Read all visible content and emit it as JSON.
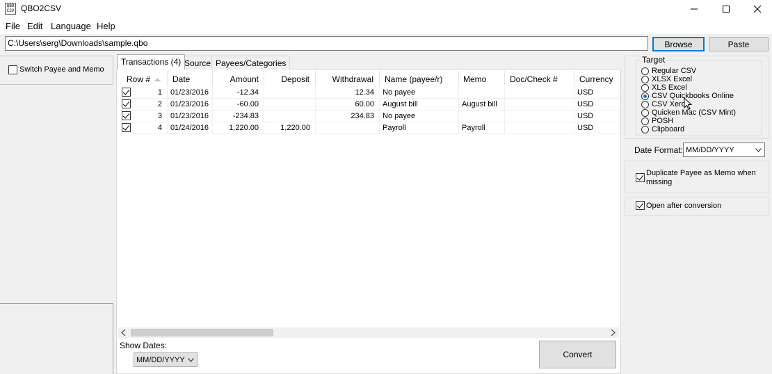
{
  "window": {
    "title": "QBO2CSV",
    "icon_text": "QBO\nCSV",
    "minimize": "—",
    "maximize": "☐",
    "close": "✕"
  },
  "menu": [
    "File",
    "Edit",
    "Language",
    "Help"
  ],
  "path": {
    "value": "C:\\Users\\serg\\Downloads\\sample.qbo",
    "browse_label": "Browse",
    "paste_label": "Paste"
  },
  "left": {
    "switch_label": "Switch Payee and Memo",
    "switch_checked": false
  },
  "tabs": [
    {
      "label": "Transactions (4)",
      "active": true
    },
    {
      "label": "Source",
      "active": false
    },
    {
      "label": "Payees/Categories",
      "active": false
    }
  ],
  "table": {
    "columns": [
      "Row #",
      "Date",
      "Amount",
      "Deposit",
      "Withdrawal",
      "Name (payee/r)",
      "Memo",
      "Doc/Check #",
      "Currency"
    ],
    "rows": [
      {
        "checked": true,
        "row": "1",
        "date": "01/23/2016",
        "amount": "-12.34",
        "deposit": "",
        "withdrawal": "12.34",
        "name": "No payee",
        "memo": "",
        "doc": "",
        "currency": "USD"
      },
      {
        "checked": true,
        "row": "2",
        "date": "01/23/2016",
        "amount": "-60.00",
        "deposit": "",
        "withdrawal": "60.00",
        "name": "August bill",
        "memo": "August bill",
        "doc": "",
        "currency": "USD"
      },
      {
        "checked": true,
        "row": "3",
        "date": "01/23/2016",
        "amount": "-234.83",
        "deposit": "",
        "withdrawal": "234.83",
        "name": "No payee",
        "memo": "",
        "doc": "",
        "currency": "USD"
      },
      {
        "checked": true,
        "row": "4",
        "date": "01/24/2016",
        "amount": "1,220.00",
        "deposit": "1,220.00",
        "withdrawal": "",
        "name": "Payroll",
        "memo": "Payroll",
        "doc": "",
        "currency": "USD"
      }
    ]
  },
  "bottom": {
    "show_dates_label": "Show Dates:",
    "show_dates_value": "MM/DD/YYYY",
    "convert_label": "Convert"
  },
  "target": {
    "legend": "Target",
    "options": [
      {
        "label": "Regular CSV",
        "selected": false
      },
      {
        "label": "XLSX Excel",
        "selected": false
      },
      {
        "label": "XLS Excel",
        "selected": false
      },
      {
        "label": "CSV Quickbooks Online",
        "selected": true
      },
      {
        "label": "CSV Xero",
        "selected": false
      },
      {
        "label": "Quicken Mac (CSV Mint)",
        "selected": false
      },
      {
        "label": "POSH",
        "selected": false
      },
      {
        "label": "Clipboard",
        "selected": false
      }
    ],
    "date_format_label": "Date Format:",
    "date_format_value": "MM/DD/YYYY"
  },
  "options": {
    "duplicate_label": "Duplicate Payee as Memo when missing",
    "duplicate_checked": true,
    "open_after_label": "Open after conversion",
    "open_after_checked": true
  }
}
